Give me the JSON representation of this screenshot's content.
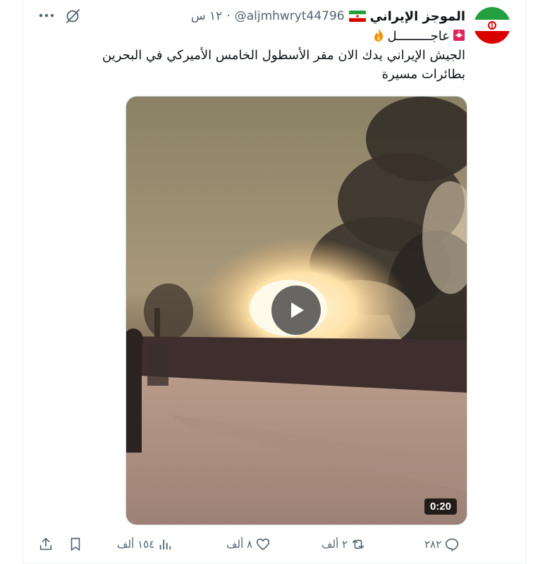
{
  "tweet": {
    "author_name": "الموجز الإيراني",
    "handle": "@aljmhwryt44796",
    "time": "١٢ س",
    "separator": "·",
    "line1_text": "عاجـــــــــل",
    "line2_text": "الجيش الإيراني يدك الان مقر الأسطول الخامس الأميركي في البحرين",
    "line3_text": "بطائرات مسيرة"
  },
  "video": {
    "duration": "0:20"
  },
  "actions": {
    "replies": "٢٨٢",
    "retweets": "٢ ألف",
    "likes": "٨ ألف",
    "views": "١٥٤ ألف"
  },
  "icons": {
    "more": "more-horizontal-icon",
    "grok": "grok-icon",
    "reply": "reply-icon",
    "retweet": "retweet-icon",
    "like": "heart-icon",
    "views": "analytics-icon",
    "bookmark": "bookmark-icon",
    "share": "share-icon",
    "play": "play-icon"
  },
  "colors": {
    "text": "#0f1419",
    "secondary": "#536471",
    "border": "#eff3f4"
  }
}
